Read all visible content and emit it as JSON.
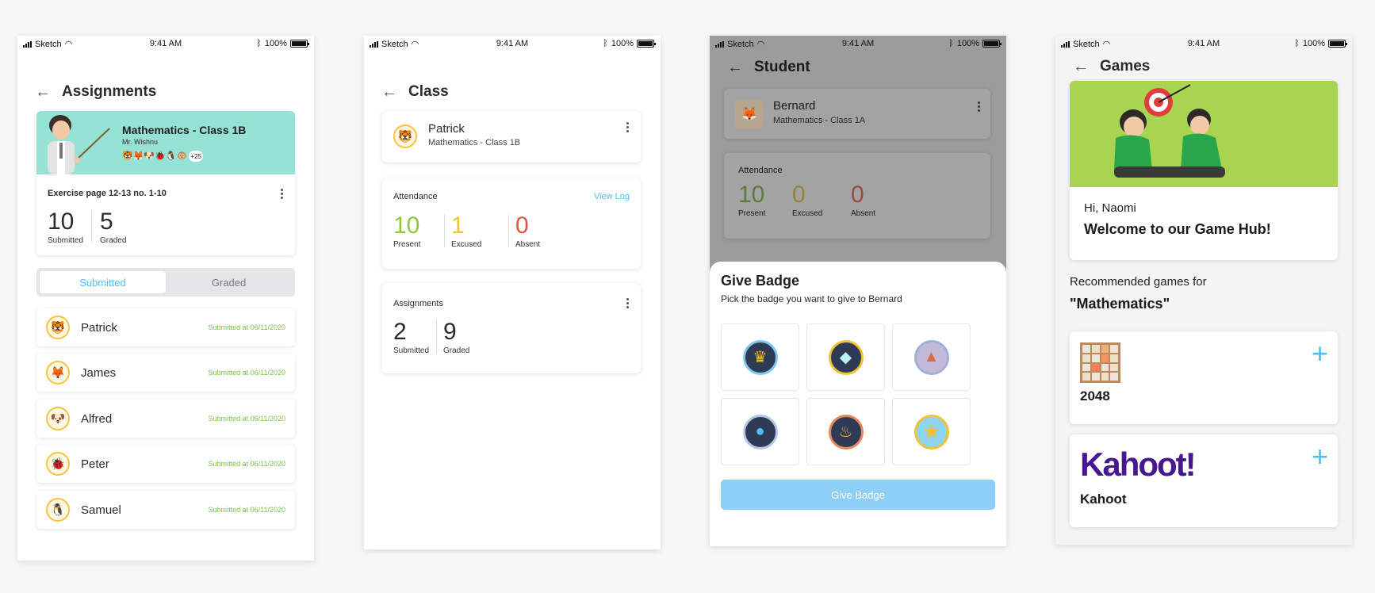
{
  "status": {
    "carrier": "Sketch",
    "time": "9:41 AM",
    "battery": "100%"
  },
  "p1": {
    "title": "Assignments",
    "subject": "Mathematics - Class 1B",
    "teacher": "Mr. Wishnu",
    "more_count": "+25",
    "exercise": "Exercise page 12-13 no. 1-10",
    "submitted_value": "10",
    "submitted_label": "Submitted",
    "graded_value": "5",
    "graded_label": "Graded",
    "tabs": [
      "Submitted",
      "Graded"
    ],
    "students": [
      {
        "name": "Patrick",
        "emoji": "🐯",
        "status": "Submitted at 06/11/2020"
      },
      {
        "name": "James",
        "emoji": "🦊",
        "status": "Submitted at 06/11/2020"
      },
      {
        "name": "Alfred",
        "emoji": "🐶",
        "status": "Submitted at 06/11/2020"
      },
      {
        "name": "Peter",
        "emoji": "🐞",
        "status": "Submitted at 06/11/2020"
      },
      {
        "name": "Samuel",
        "emoji": "🐧",
        "status": "Submitted at 06/11/2020"
      }
    ]
  },
  "p2": {
    "title": "Class",
    "student_name": "Patrick",
    "student_class": "Mathematics - Class 1B",
    "attendance_label": "Attendance",
    "view_log": "View Log",
    "present_value": "10",
    "present_label": "Present",
    "excused_value": "1",
    "excused_label": "Excused",
    "absent_value": "0",
    "absent_label": "Absent",
    "assignments_label": "Assignments",
    "submitted_value": "2",
    "submitted_label": "Submitted",
    "graded_value": "9",
    "graded_label": "Graded"
  },
  "p3": {
    "title": "Student",
    "student_name": "Bernard",
    "student_class": "Mathematics - Class 1A",
    "attendance_label": "Attendance",
    "present_value": "10",
    "present_label": "Present",
    "excused_value": "0",
    "excused_label": "Excused",
    "absent_value": "0",
    "absent_label": "Absent",
    "sheet_title": "Give Badge",
    "sheet_subtitle": "Pick the badge you want to give to Bernard",
    "give_button": "Give Badge"
  },
  "p4": {
    "title": "Games",
    "greeting": "Hi, Naomi",
    "welcome": "Welcome to our Game Hub!",
    "recommended": "Recommended games for",
    "subject": "\"Mathematics\"",
    "game1": "2048",
    "game2": "Kahoot",
    "kahoot_logo": "Kahoot!"
  },
  "colors": {
    "accent": "#4fbef5",
    "present": "#8dc63f",
    "excused": "#f2c230",
    "absent": "#e8553e",
    "banner": "#96e3d6",
    "game_banner": "#a9d452"
  }
}
